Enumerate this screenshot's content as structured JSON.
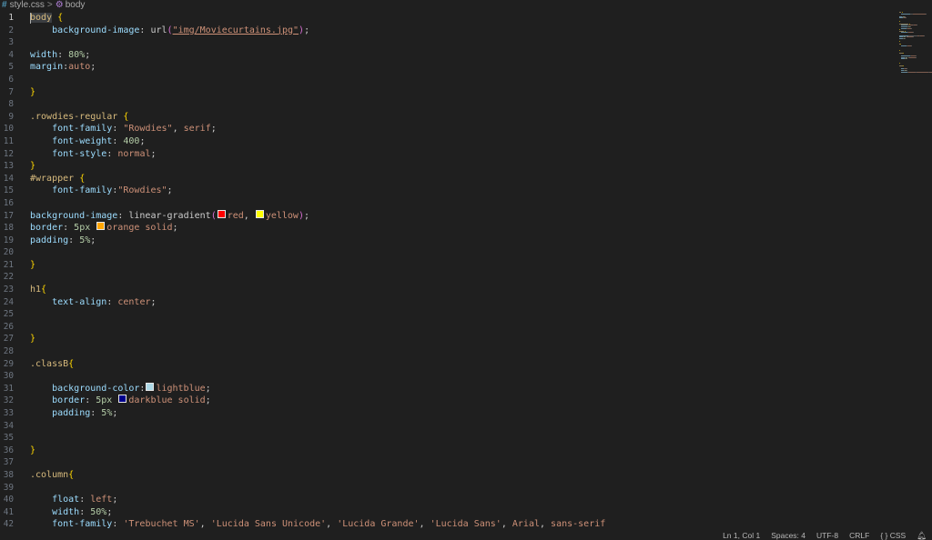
{
  "breadcrumb": {
    "file": "style.css",
    "separator": ">",
    "symbol": "body",
    "file_icon": "css-hash-icon",
    "symbol_icon": "symbol-class-icon"
  },
  "editor": {
    "active_line": 1,
    "lines": [
      {
        "n": "1",
        "tokens": [
          [
            "sel",
            "body"
          ],
          [
            "punc",
            " "
          ],
          [
            "b1",
            "{"
          ]
        ]
      },
      {
        "n": "2",
        "tokens": [
          [
            "punc",
            "    "
          ],
          [
            "prop",
            "background-image"
          ],
          [
            "punc",
            ": url"
          ],
          [
            "b2",
            "("
          ],
          [
            "val",
            "\"img/Moviecurtains.jpg\""
          ],
          [
            "b2",
            ")"
          ],
          [
            "punc",
            ";"
          ]
        ]
      },
      {
        "n": "3",
        "tokens": []
      },
      {
        "n": "4",
        "tokens": [
          [
            "prop",
            "width"
          ],
          [
            "punc",
            ": "
          ],
          [
            "num",
            "80%"
          ],
          [
            "punc",
            ";"
          ]
        ]
      },
      {
        "n": "5",
        "tokens": [
          [
            "prop",
            "margin"
          ],
          [
            "punc",
            ":"
          ],
          [
            "val",
            "auto"
          ],
          [
            "punc",
            ";"
          ]
        ]
      },
      {
        "n": "6",
        "tokens": []
      },
      {
        "n": "7",
        "tokens": [
          [
            "b1",
            "}"
          ]
        ]
      },
      {
        "n": "8",
        "tokens": []
      },
      {
        "n": "9",
        "tokens": [
          [
            "sel",
            ".rowdies-regular"
          ],
          [
            "punc",
            " "
          ],
          [
            "b1",
            "{"
          ]
        ]
      },
      {
        "n": "10",
        "tokens": [
          [
            "punc",
            "    "
          ],
          [
            "prop",
            "font-family"
          ],
          [
            "punc",
            ": "
          ],
          [
            "val",
            "\"Rowdies\""
          ],
          [
            "punc",
            ", "
          ],
          [
            "val",
            "serif"
          ],
          [
            "punc",
            ";"
          ]
        ]
      },
      {
        "n": "11",
        "tokens": [
          [
            "punc",
            "    "
          ],
          [
            "prop",
            "font-weight"
          ],
          [
            "punc",
            ": "
          ],
          [
            "num",
            "400"
          ],
          [
            "punc",
            ";"
          ]
        ]
      },
      {
        "n": "12",
        "tokens": [
          [
            "punc",
            "    "
          ],
          [
            "prop",
            "font-style"
          ],
          [
            "punc",
            ": "
          ],
          [
            "val",
            "normal"
          ],
          [
            "punc",
            ";"
          ]
        ]
      },
      {
        "n": "13",
        "tokens": [
          [
            "b1",
            "}"
          ]
        ]
      },
      {
        "n": "14",
        "tokens": [
          [
            "sel",
            "#wrapper"
          ],
          [
            "punc",
            " "
          ],
          [
            "b1",
            "{"
          ]
        ]
      },
      {
        "n": "15",
        "tokens": [
          [
            "punc",
            "    "
          ],
          [
            "prop",
            "font-family"
          ],
          [
            "punc",
            ":"
          ],
          [
            "val",
            "\"Rowdies\""
          ],
          [
            "punc",
            ";"
          ]
        ]
      },
      {
        "n": "16",
        "tokens": []
      },
      {
        "n": "17",
        "tokens": [
          [
            "prop",
            "background-image"
          ],
          [
            "punc",
            ": linear-gradient"
          ],
          [
            "b2",
            "("
          ],
          [
            "swatch",
            "#ff0000"
          ],
          [
            "val",
            "red"
          ],
          [
            "punc",
            ", "
          ],
          [
            "swatch",
            "#ffff00"
          ],
          [
            "val",
            "yellow"
          ],
          [
            "b2",
            ")"
          ],
          [
            "punc",
            ";"
          ]
        ]
      },
      {
        "n": "18",
        "tokens": [
          [
            "prop",
            "border"
          ],
          [
            "punc",
            ": "
          ],
          [
            "num",
            "5px"
          ],
          [
            "punc",
            " "
          ],
          [
            "swatch",
            "#ffa500"
          ],
          [
            "val",
            "orange solid"
          ],
          [
            "punc",
            ";"
          ]
        ]
      },
      {
        "n": "19",
        "tokens": [
          [
            "prop",
            "padding"
          ],
          [
            "punc",
            ": "
          ],
          [
            "num",
            "5%"
          ],
          [
            "punc",
            ";"
          ]
        ]
      },
      {
        "n": "20",
        "tokens": []
      },
      {
        "n": "21",
        "tokens": [
          [
            "b1",
            "}"
          ]
        ]
      },
      {
        "n": "22",
        "tokens": []
      },
      {
        "n": "23",
        "tokens": [
          [
            "sel",
            "h1"
          ],
          [
            "b1",
            "{"
          ]
        ]
      },
      {
        "n": "24",
        "tokens": [
          [
            "punc",
            "    "
          ],
          [
            "prop",
            "text-align"
          ],
          [
            "punc",
            ": "
          ],
          [
            "val",
            "center"
          ],
          [
            "punc",
            ";"
          ]
        ]
      },
      {
        "n": "25",
        "tokens": []
      },
      {
        "n": "26",
        "tokens": []
      },
      {
        "n": "27",
        "tokens": [
          [
            "b1",
            "}"
          ]
        ]
      },
      {
        "n": "28",
        "tokens": []
      },
      {
        "n": "29",
        "tokens": [
          [
            "sel",
            ".classB"
          ],
          [
            "b1",
            "{"
          ]
        ]
      },
      {
        "n": "30",
        "tokens": []
      },
      {
        "n": "31",
        "tokens": [
          [
            "punc",
            "    "
          ],
          [
            "prop",
            "background-color"
          ],
          [
            "punc",
            ":"
          ],
          [
            "swatch",
            "#add8e6"
          ],
          [
            "val",
            "lightblue"
          ],
          [
            "punc",
            ";"
          ]
        ]
      },
      {
        "n": "32",
        "tokens": [
          [
            "punc",
            "    "
          ],
          [
            "prop",
            "border"
          ],
          [
            "punc",
            ": "
          ],
          [
            "num",
            "5px"
          ],
          [
            "punc",
            " "
          ],
          [
            "swatch",
            "#00008b"
          ],
          [
            "val",
            "darkblue solid"
          ],
          [
            "punc",
            ";"
          ]
        ]
      },
      {
        "n": "33",
        "tokens": [
          [
            "punc",
            "    "
          ],
          [
            "prop",
            "padding"
          ],
          [
            "punc",
            ": "
          ],
          [
            "num",
            "5%"
          ],
          [
            "punc",
            ";"
          ]
        ]
      },
      {
        "n": "34",
        "tokens": []
      },
      {
        "n": "35",
        "tokens": []
      },
      {
        "n": "36",
        "tokens": [
          [
            "b1",
            "}"
          ]
        ]
      },
      {
        "n": "37",
        "tokens": []
      },
      {
        "n": "38",
        "tokens": [
          [
            "sel",
            ".column"
          ],
          [
            "b1",
            "{"
          ]
        ]
      },
      {
        "n": "39",
        "tokens": []
      },
      {
        "n": "40",
        "tokens": [
          [
            "punc",
            "    "
          ],
          [
            "prop",
            "float"
          ],
          [
            "punc",
            ": "
          ],
          [
            "val",
            "left"
          ],
          [
            "punc",
            ";"
          ]
        ]
      },
      {
        "n": "41",
        "tokens": [
          [
            "punc",
            "    "
          ],
          [
            "prop",
            "width"
          ],
          [
            "punc",
            ": "
          ],
          [
            "num",
            "50%"
          ],
          [
            "punc",
            ";"
          ]
        ]
      },
      {
        "n": "42",
        "tokens": [
          [
            "punc",
            "    "
          ],
          [
            "prop",
            "font-family"
          ],
          [
            "punc",
            ": "
          ],
          [
            "val",
            "'Trebuchet MS'"
          ],
          [
            "punc",
            ", "
          ],
          [
            "val",
            "'Lucida Sans Unicode'"
          ],
          [
            "punc",
            ", "
          ],
          [
            "val",
            "'Lucida Grande'"
          ],
          [
            "punc",
            ", "
          ],
          [
            "val",
            "'Lucida Sans'"
          ],
          [
            "punc",
            ", "
          ],
          [
            "val",
            "Arial"
          ],
          [
            "punc",
            ", "
          ],
          [
            "val",
            "sans-serif"
          ]
        ]
      }
    ]
  },
  "statusbar": {
    "position": "Ln 1, Col 1",
    "spaces": "Spaces: 4",
    "encoding": "UTF-8",
    "eol": "CRLF",
    "language": "{ } CSS",
    "notification_icon": "bell-icon"
  },
  "colors": {
    "background": "#1f1f1f",
    "selector": "#d7ba7d",
    "property": "#9cdcfe",
    "value": "#ce9178",
    "number": "#b5cea8",
    "bracket1": "#ffd700",
    "bracket2": "#da70d6"
  }
}
